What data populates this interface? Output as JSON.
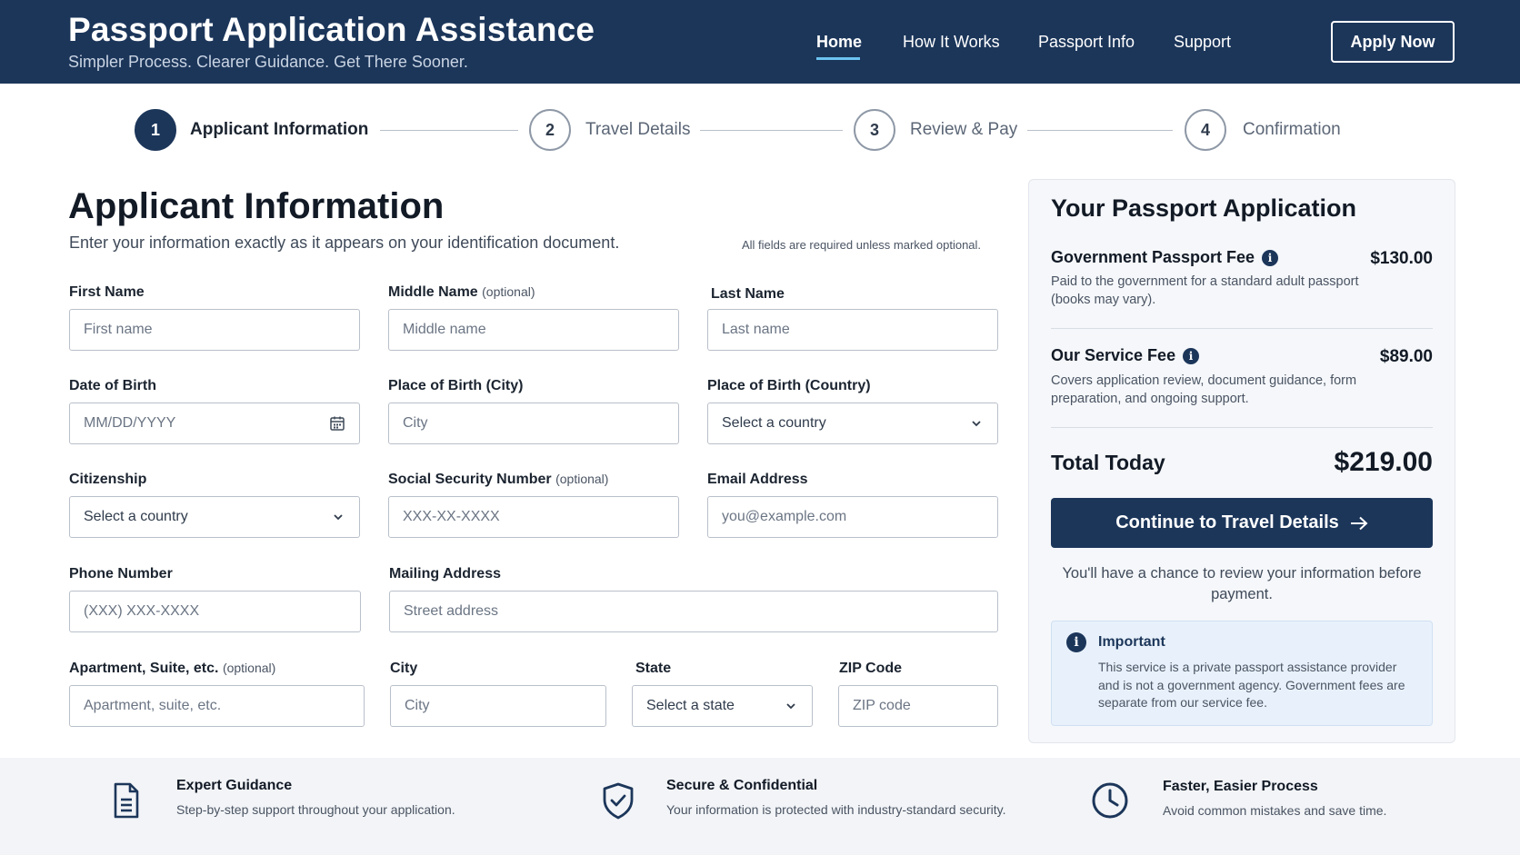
{
  "header": {
    "title": "Passport Application Assistance",
    "subtitle": "Simpler Process. Clearer Guidance. Get There Sooner.",
    "nav": [
      {
        "label": "Home",
        "active": true
      },
      {
        "label": "How It Works",
        "active": false
      },
      {
        "label": "Passport Info",
        "active": false
      },
      {
        "label": "Support",
        "active": false
      }
    ],
    "cta_label": "Apply Now"
  },
  "steps": [
    {
      "number": "1",
      "label": "Applicant Information",
      "active": true
    },
    {
      "number": "2",
      "label": "Travel Details",
      "active": false
    },
    {
      "number": "3",
      "label": "Review & Pay",
      "active": false
    },
    {
      "number": "4",
      "label": "Confirmation",
      "active": false
    }
  ],
  "form": {
    "title": "Applicant Information",
    "subtitle": "Enter your information exactly as it appears on your identification document.",
    "required_note": "All fields are required unless marked optional.",
    "optional_tag": "(optional)",
    "fields": {
      "first_name": {
        "label": "First Name",
        "placeholder": "First name"
      },
      "middle_name": {
        "label": "Middle Name",
        "placeholder": "Middle name"
      },
      "last_name": {
        "label": "Last Name",
        "placeholder": "Last name"
      },
      "dob": {
        "label": "Date of Birth",
        "placeholder": "MM/DD/YYYY"
      },
      "birth_city": {
        "label": "Place of Birth (City)",
        "placeholder": "City"
      },
      "birth_country": {
        "label": "Place of Birth (Country)",
        "value": "Select a country"
      },
      "citizenship": {
        "label": "Citizenship",
        "value": "Select a country"
      },
      "ssn": {
        "label": "Social Security Number",
        "placeholder": "XXX-XX-XXXX"
      },
      "email": {
        "label": "Email Address",
        "placeholder": "you@example.com"
      },
      "phone": {
        "label": "Phone Number",
        "placeholder": "(XXX) XXX-XXXX"
      },
      "mailing": {
        "label": "Mailing Address",
        "placeholder": "Street address"
      },
      "apartment": {
        "label": "Apartment, Suite, etc.",
        "placeholder": "Apartment, suite, etc."
      },
      "city": {
        "label": "City",
        "placeholder": "City"
      },
      "state": {
        "label": "State",
        "value": "Select a state"
      },
      "zip": {
        "label": "ZIP Code",
        "placeholder": "ZIP code"
      }
    }
  },
  "summary": {
    "title": "Your Passport Application",
    "gov_fee": {
      "label": "Government Passport Fee",
      "amount": "$130.00",
      "description": "Paid to the government for a standard adult passport (books may vary)."
    },
    "service_fee": {
      "label": "Our Service Fee",
      "amount": "$89.00",
      "description": "Covers application review, document guidance, form preparation, and ongoing support."
    },
    "total_label": "Total Today",
    "total_amount": "$219.00",
    "continue_label": "Continue to Travel Details",
    "review_note": "You'll have a chance to review your information before payment.",
    "important": {
      "title": "Important",
      "text": "This service is a private passport assistance provider and is not a government agency. Government fees are separate from our service fee."
    }
  },
  "features": [
    {
      "icon": "document-icon",
      "title": "Expert Guidance",
      "text": "Step-by-step support throughout your application."
    },
    {
      "icon": "shield-check-icon",
      "title": "Secure & Confidential",
      "text": "Your information is protected with industry-standard security."
    },
    {
      "icon": "clock-icon",
      "title": "Faster, Easier Process",
      "text": "Avoid common mistakes and save time."
    }
  ],
  "colors": {
    "header_bg": "#1c365a",
    "accent_underline": "#6cc3f0",
    "primary": "#1c365a",
    "card_bg": "#f5f7fa",
    "notice_bg": "#e8f1fb"
  }
}
